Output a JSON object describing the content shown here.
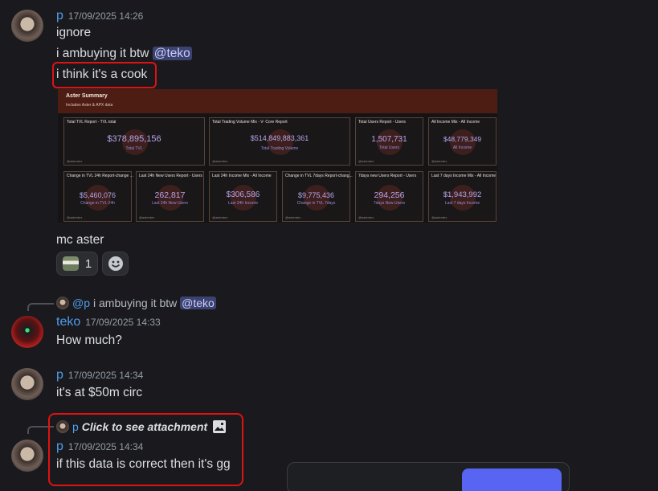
{
  "messages": [
    {
      "author": "p",
      "timestamp": "17/09/2025 14:26",
      "lines": [
        "ignore",
        "i ambuying it btw ",
        "i think it's a cook"
      ],
      "mention": "@teko",
      "after_image": "mc aster",
      "reaction_count": "1"
    },
    {
      "reply_author": "@p",
      "reply_text": "i ambuying it btw ",
      "reply_mention": "@teko",
      "author": "teko",
      "timestamp": "17/09/2025 14:33",
      "text": "How much?"
    },
    {
      "author": "p",
      "timestamp": "17/09/2025 14:34",
      "text": "it's at $50m circ"
    },
    {
      "reply_author": "p",
      "reply_text": "Click to see attachment",
      "author": "p",
      "timestamp": "17/09/2025 14:34",
      "text": "if this data is correct then it's gg"
    }
  ],
  "embed": {
    "title": "Aster Summary",
    "subtitle": "Includes Aster & APX data",
    "footer": "@asterdex",
    "cards": [
      {
        "title": "Total TVL   Report - TVL total",
        "value": "$378,895,156",
        "sub": "Total TVL"
      },
      {
        "title": "Total Trading Volume   Mix - V- Core Report",
        "value": "$514,849,883,361",
        "sub": "Total Trading Volume"
      },
      {
        "title": "Total Users   Report - Users",
        "value": "1,507,731",
        "sub": "Total Users"
      },
      {
        "title": "All Income   Mix - All Income",
        "value": "$48,779,349",
        "sub": "All Income"
      },
      {
        "title": "Change in TVL 24h   Report-change ...",
        "value": "$5,460,076",
        "sub": "Change in TVL 24h"
      },
      {
        "title": "Last 24h New Users   Report - Users",
        "value": "262,817",
        "sub": "Last 24h New Users"
      },
      {
        "title": "Last 24h Income   Mix - All Income",
        "value": "$306,586",
        "sub": "Last 24h Income"
      },
      {
        "title": "Change in TVL 7days   Report-chang...",
        "value": "$9,775,436",
        "sub": "Change in TVL 7days"
      },
      {
        "title": "7days new Users   Report - Users",
        "value": "294,256",
        "sub": "7days New Users"
      },
      {
        "title": "Last 7 days Income   Mix - All Income",
        "value": "$1,943,992",
        "sub": "Last 7 days Income"
      }
    ]
  },
  "colors": {
    "background": "#1a1a1e",
    "username": "#4f9ded",
    "annotation": "#e01212",
    "mention_bg": "#3c4270"
  }
}
